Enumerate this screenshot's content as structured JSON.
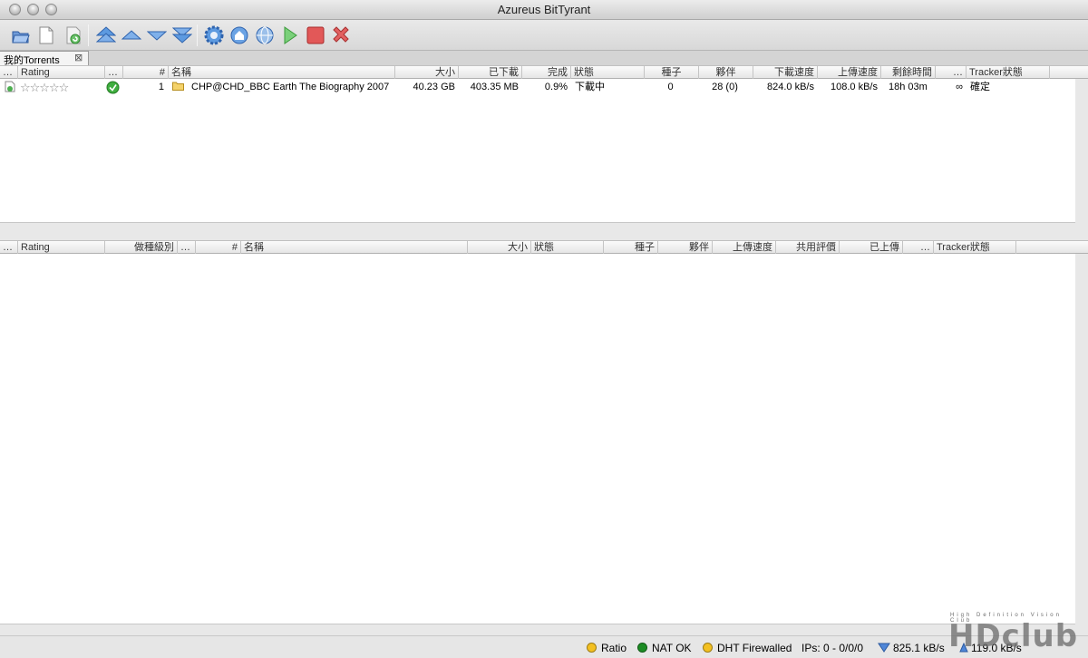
{
  "window": {
    "title": "Azureus BitTyrant"
  },
  "toolbar": {
    "buttons": [
      "open-torrent",
      "new-torrent",
      "open-url",
      "move-top",
      "move-up",
      "move-down",
      "move-bottom",
      "options",
      "home",
      "search",
      "start",
      "stop",
      "remove"
    ]
  },
  "tabs": [
    {
      "label": "我的Torrents"
    }
  ],
  "downloading": {
    "columns": [
      "…",
      "Rating",
      "…",
      "#",
      "名稱",
      "大小",
      "已下載",
      "完成",
      "狀態",
      "種子",
      "夥伴",
      "下載速度",
      "上傳速度",
      "剩餘時間",
      "…",
      "Tracker狀態"
    ],
    "rows": [
      {
        "number": "1",
        "name": "CHP@CHD_BBC Earth The Biography 2007",
        "size": "40.23 GB",
        "downloaded": "403.35 MB",
        "done": "0.9%",
        "status": "下載中",
        "seeds": "0",
        "peers": "28 (0)",
        "down_speed": "824.0 kB/s",
        "up_speed": "108.0 kB/s",
        "eta": "18h 03m",
        "share_ratio": "∞",
        "tracker_status": "確定",
        "rating_stars": "☆☆☆☆☆"
      }
    ]
  },
  "seeding": {
    "columns": [
      "…",
      "Rating",
      "做種級別",
      "…",
      "#",
      "名稱",
      "大小",
      "狀態",
      "種子",
      "夥伴",
      "上傳速度",
      "共用評價",
      "已上傳",
      "…",
      "Tracker狀態"
    ]
  },
  "statusbar": {
    "ratio_label": "Ratio",
    "nat_label": "NAT OK",
    "dht_label": "DHT Firewalled",
    "ips_label": "IPs: 0 - 0/0/0",
    "down_speed": "825.1 kB/s",
    "up_speed": "119.0 kB/s",
    "colors": {
      "ratio": "#f3c021",
      "nat": "#1c8c24",
      "dht": "#f3c021"
    }
  },
  "watermark": {
    "text": "HDclub",
    "tagline": "High Definition Vision Club"
  }
}
